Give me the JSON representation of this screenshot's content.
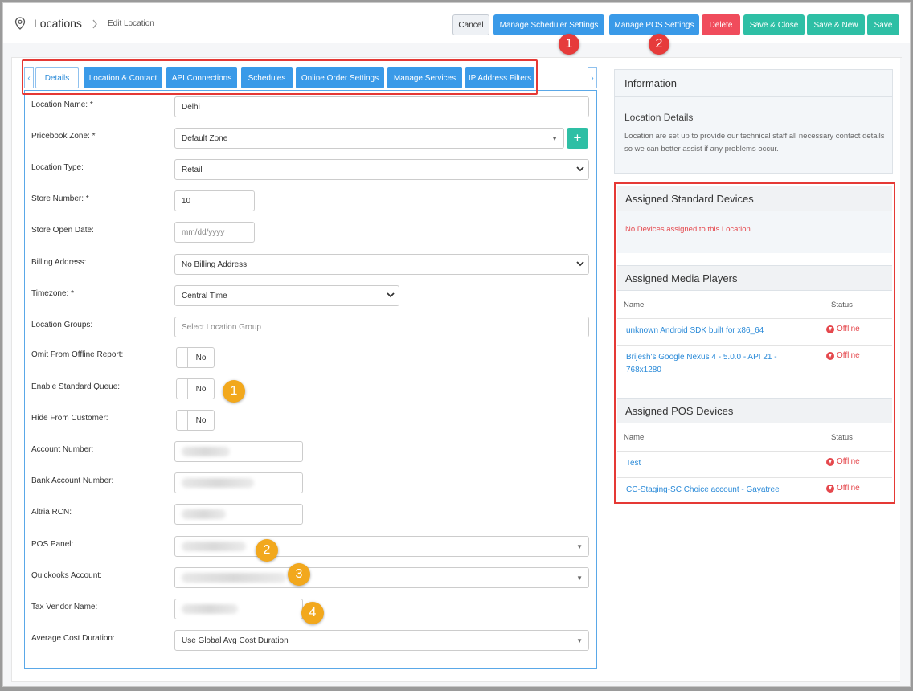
{
  "header": {
    "title": "Locations",
    "sub": "Edit Location",
    "buttons": {
      "cancel": "Cancel",
      "scheduler": "Manage Scheduler Settings",
      "pos": "Manage POS Settings",
      "delete": "Delete",
      "save_close": "Save & Close",
      "save_new": "Save & New",
      "save": "Save"
    },
    "badges": [
      "1",
      "2"
    ]
  },
  "tabs": [
    "Details",
    "Location & Contact",
    "API Connections",
    "Schedules",
    "Online Order Settings",
    "Manage Services",
    "IP Address Filters"
  ],
  "form": {
    "location_name": {
      "label": "Location Name: *",
      "value": "Delhi"
    },
    "pricebook_zone": {
      "label": "Pricebook Zone: *",
      "value": "Default Zone"
    },
    "location_type": {
      "label": "Location Type:",
      "value": "Retail"
    },
    "store_number": {
      "label": "Store Number: *",
      "value": "10"
    },
    "store_open_date": {
      "label": "Store Open Date:",
      "placeholder": "mm/dd/yyyy"
    },
    "billing_address": {
      "label": "Billing Address:",
      "value": "No Billing Address"
    },
    "timezone": {
      "label": "Timezone: *",
      "value": "Central Time"
    },
    "location_groups": {
      "label": "Location Groups:",
      "placeholder": "Select Location Group"
    },
    "omit_offline": {
      "label": "Omit From Offline Report:",
      "value": "No"
    },
    "enable_queue": {
      "label": "Enable Standard Queue:",
      "value": "No"
    },
    "hide_customer": {
      "label": "Hide From Customer:",
      "value": "No"
    },
    "account_number": {
      "label": "Account Number:"
    },
    "bank_account": {
      "label": "Bank Account Number:"
    },
    "altria_rcn": {
      "label": "Altria RCN:"
    },
    "pos_panel": {
      "label": "POS Panel:"
    },
    "quickbooks": {
      "label": "Quickooks Account:"
    },
    "tax_vendor": {
      "label": "Tax Vendor Name:"
    },
    "avg_cost": {
      "label": "Average Cost Duration:",
      "value": "Use Global Avg Cost Duration"
    },
    "callouts": [
      "1",
      "2",
      "3",
      "4"
    ]
  },
  "info": {
    "heading": "Information",
    "title": "Location Details",
    "text": "Location are set up to provide our technical staff all necessary contact details so we can better assist if any problems occur."
  },
  "standard_devices": {
    "heading": "Assigned Standard Devices",
    "empty": "No Devices assigned to this Location"
  },
  "media_players": {
    "heading": "Assigned Media Players",
    "col_name": "Name",
    "col_status": "Status",
    "rows": [
      {
        "name": "unknown Android SDK built for x86_64",
        "status": "Offline"
      },
      {
        "name": "Brijesh's Google Nexus 4 - 5.0.0 - API 21 - 768x1280",
        "status": "Offline"
      }
    ]
  },
  "pos_devices": {
    "heading": "Assigned POS Devices",
    "col_name": "Name",
    "col_status": "Status",
    "rows": [
      {
        "name": "Test",
        "status": "Offline"
      },
      {
        "name": "CC-Staging-SC Choice account - Gayatree",
        "status": "Offline"
      }
    ]
  },
  "colors": {
    "primary": "#3a9ae8",
    "success": "#2ebfa5",
    "danger": "#f04c5c",
    "highlight": "#e53935",
    "callout": "#f2a81d"
  }
}
